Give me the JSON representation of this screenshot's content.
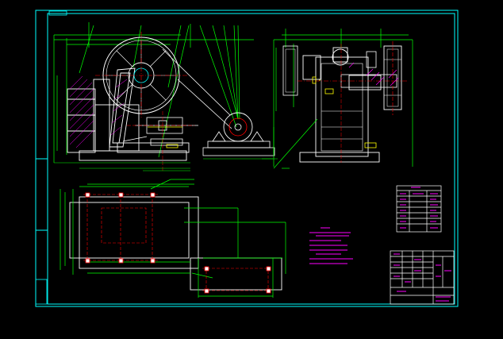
{
  "drawing": {
    "background": "#000000",
    "colors": {
      "border": "#00ffff",
      "outline": "#ffffff",
      "dimension": "#00ff00",
      "center_line": "#ff0000",
      "hidden_line": "#ffff00",
      "hatch": "#ff00ff",
      "note_text": "#ff00ff",
      "table_text": "#ff00ff"
    }
  }
}
